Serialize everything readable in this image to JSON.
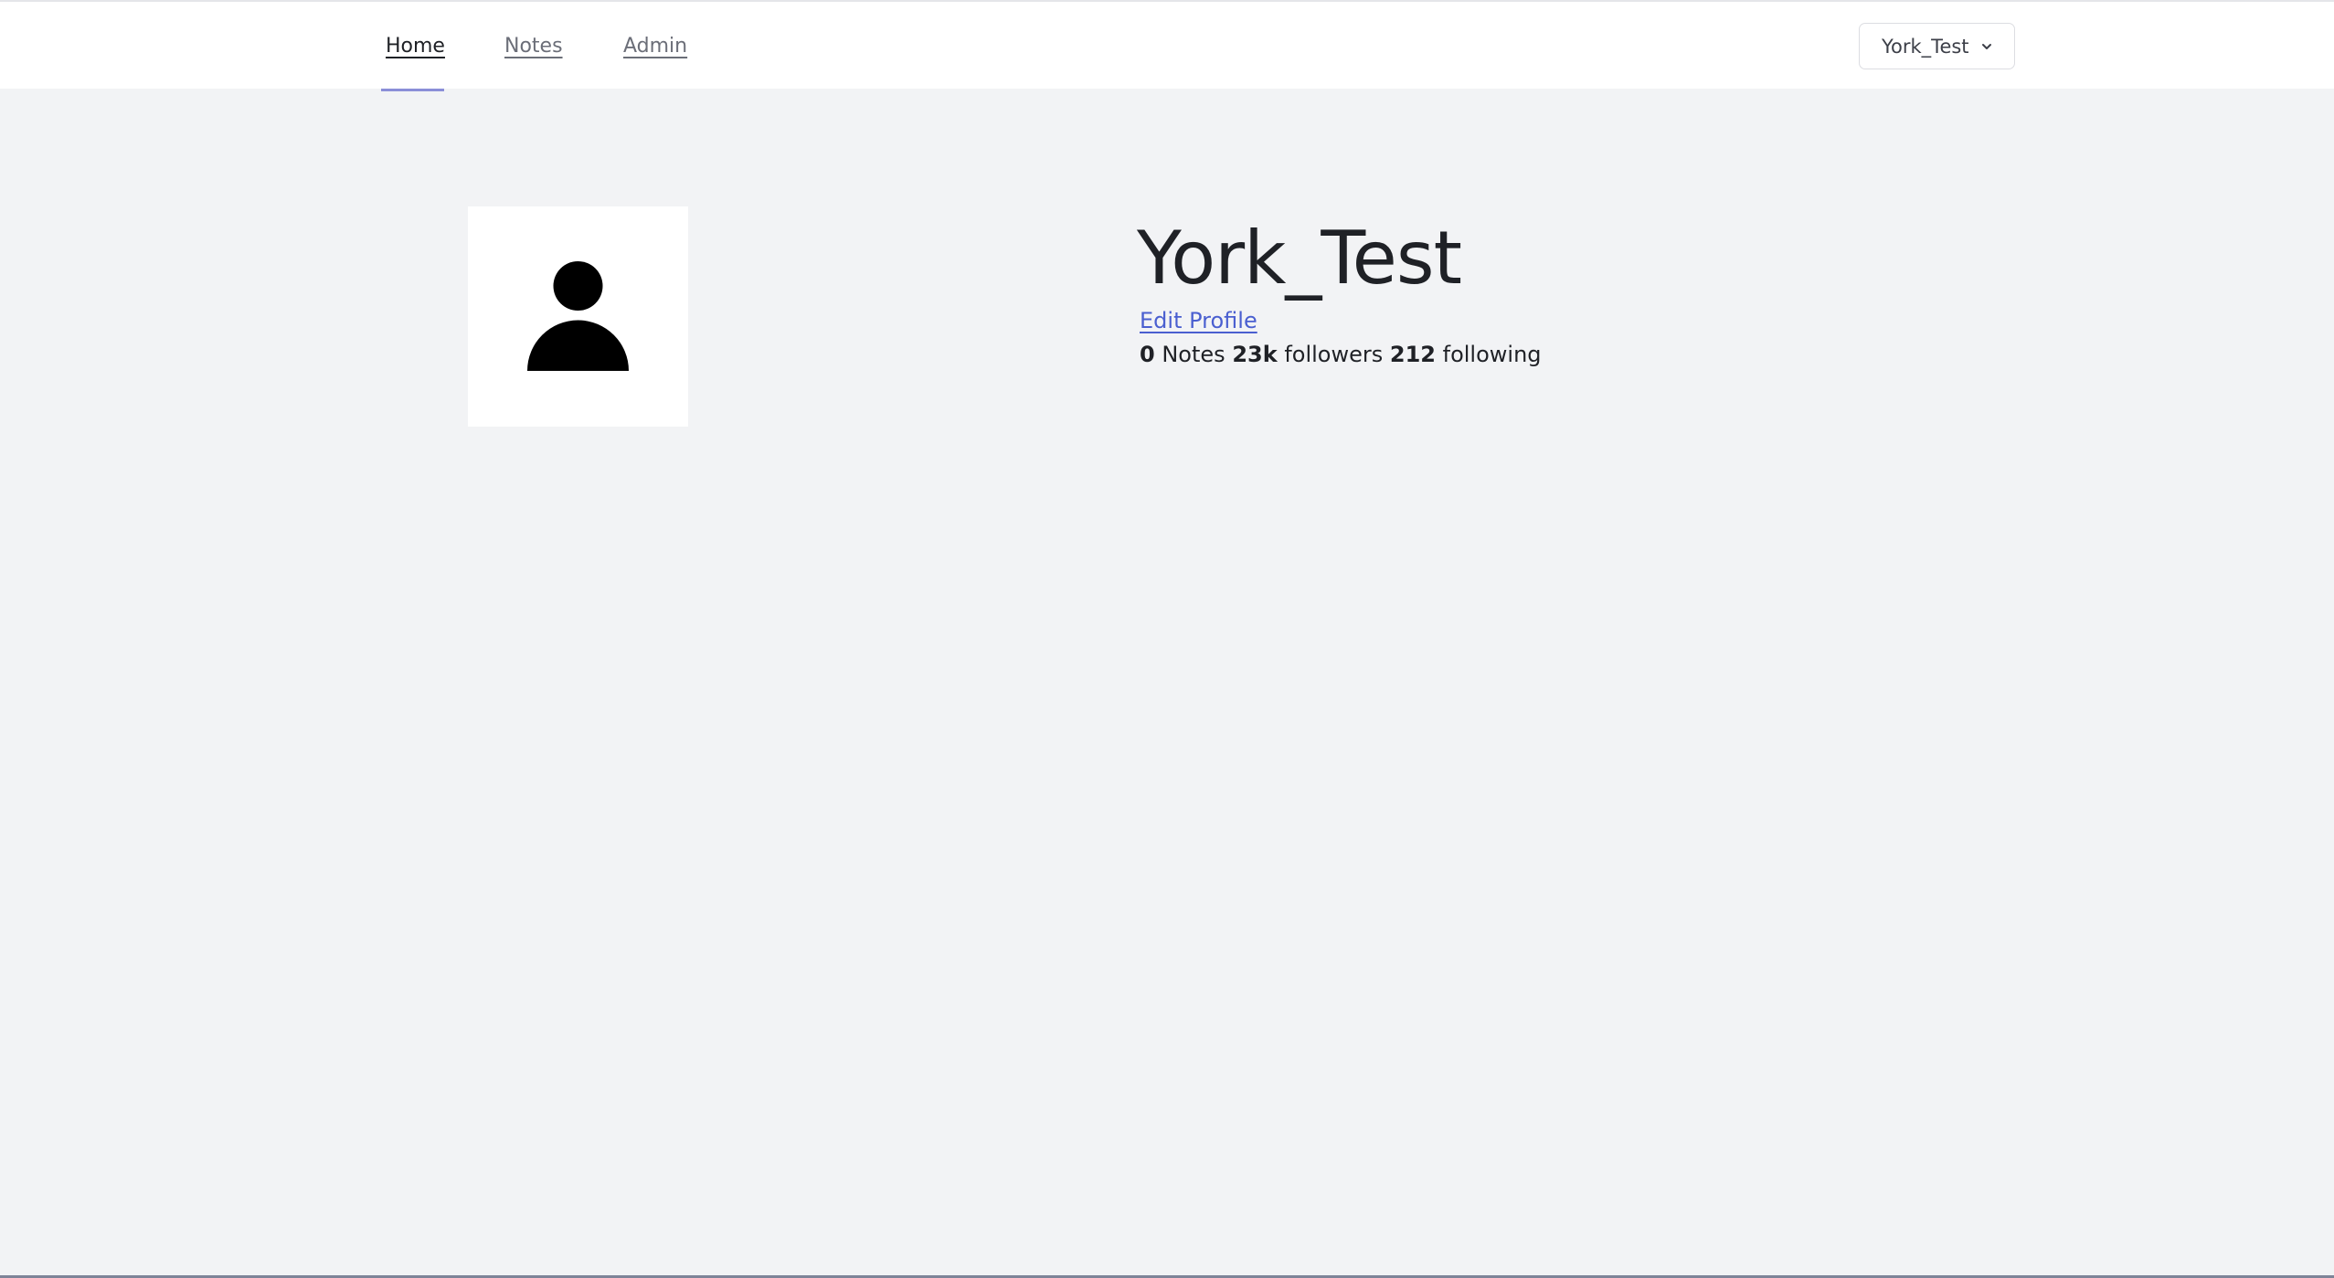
{
  "nav": {
    "items": [
      {
        "label": "Home",
        "active": true
      },
      {
        "label": "Notes",
        "active": false
      },
      {
        "label": "Admin",
        "active": false
      }
    ]
  },
  "user_menu": {
    "label": "York_Test",
    "icon": "chevron-down-icon"
  },
  "profile": {
    "avatar_icon": "user-avatar-icon",
    "name": "York_Test",
    "edit_label": "Edit Profile",
    "stats": {
      "notes_count": "0",
      "notes_label": "Notes",
      "followers_count": "23k",
      "followers_label": "followers",
      "following_count": "212",
      "following_label": "following"
    }
  },
  "colors": {
    "background": "#f2f3f5",
    "topbar": "#ffffff",
    "active_indicator": "#8b8fd8",
    "link": "#4a5fd0",
    "text": "#1f2126"
  }
}
